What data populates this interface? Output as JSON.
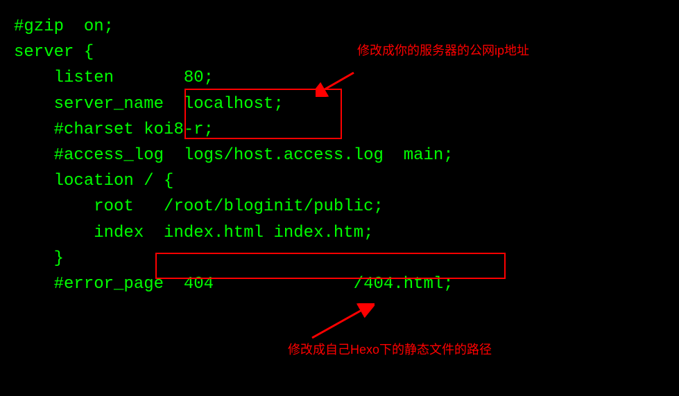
{
  "code": {
    "line1": "#gzip  on;",
    "line2": "",
    "line3": "server {",
    "line4": "    listen       80;",
    "line5": "    server_name  localhost;",
    "line6": "",
    "line7": "    #charset koi8-r;",
    "line8": "",
    "line9": "    #access_log  logs/host.access.log  main;",
    "line10": "",
    "line11": "    location / {",
    "line12": "        root   /root/bloginit/public;",
    "line13": "        index  index.html index.htm;",
    "line14": "    }",
    "line15": "",
    "line16": "    #error_page  404              /404.html;"
  },
  "annotations": {
    "top": "修改成你的服务器的公网ip地址",
    "bottom": "修改成自己Hexo下的静态文件的路径"
  }
}
